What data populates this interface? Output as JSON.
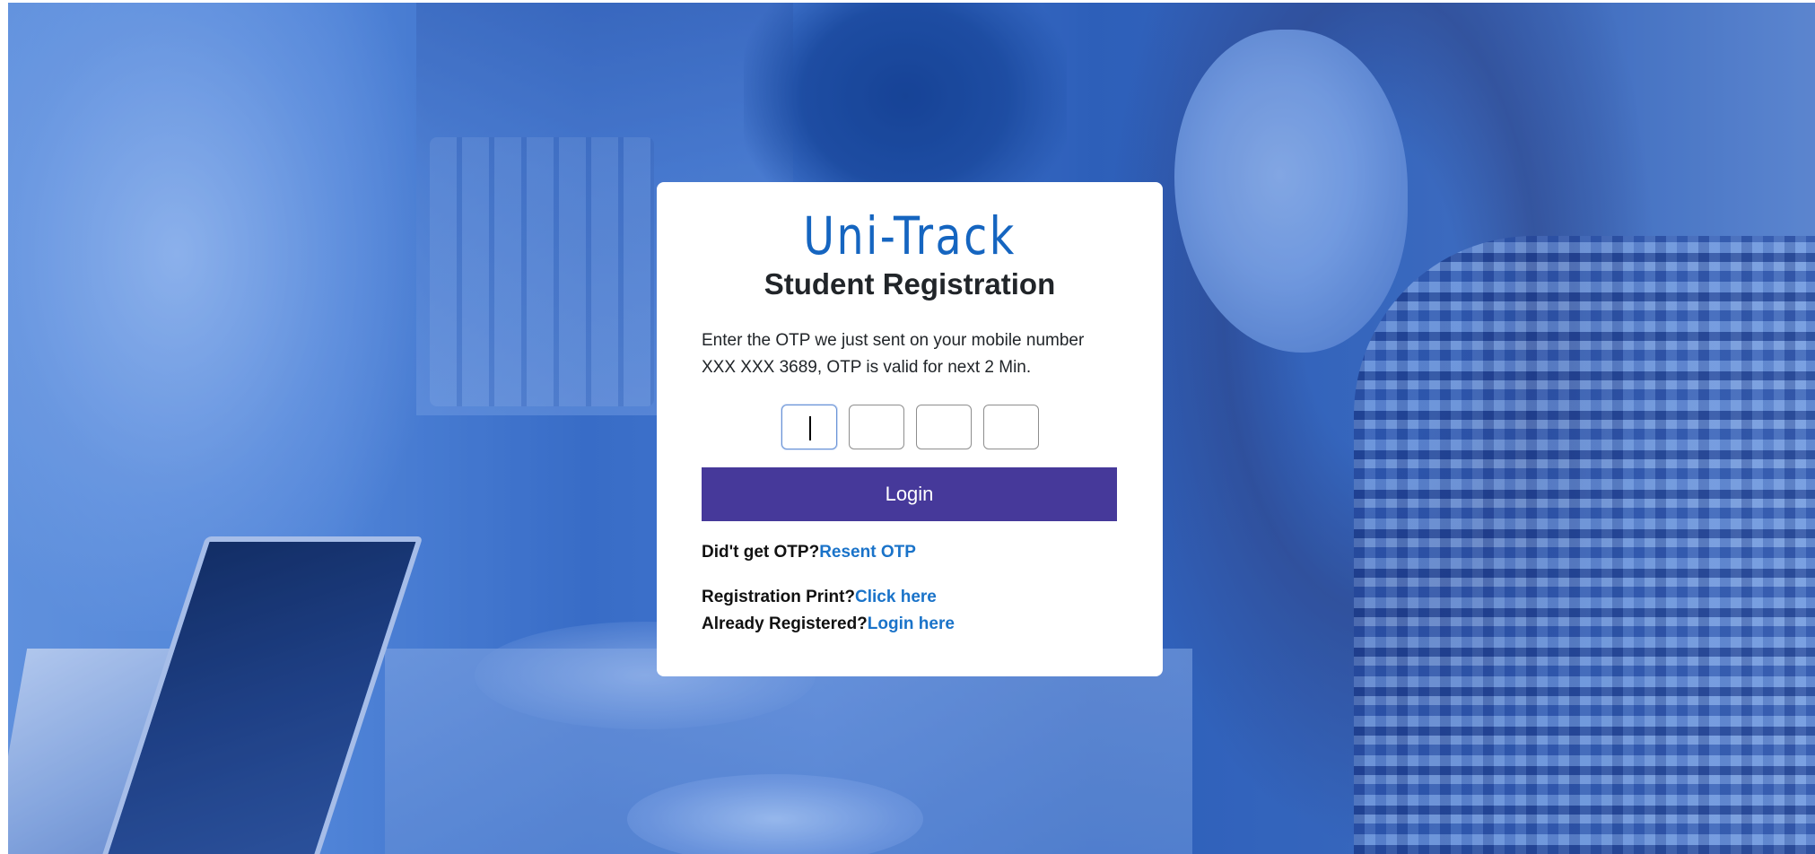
{
  "brand": {
    "name": "Uni-Track"
  },
  "page": {
    "title": "Student Registration"
  },
  "message": {
    "line1": "Enter the OTP we just sent on your mobile number",
    "line2": "XXX XXX 3689, OTP is valid for next 2 Min."
  },
  "otp": {
    "digits": [
      "",
      "",
      "",
      ""
    ],
    "active_index": 0
  },
  "login_button": {
    "label": "Login"
  },
  "resend": {
    "prompt": "Did't get OTP?",
    "link": "Resent OTP"
  },
  "print": {
    "prompt": "Registration Print?",
    "link": "Click here"
  },
  "registered": {
    "prompt": "Already Registered?",
    "link": "Login here"
  },
  "colors": {
    "brand": "#1565c0",
    "button": "#46399a",
    "link": "#1a73c9",
    "background_tint": "#3d6fc4"
  }
}
